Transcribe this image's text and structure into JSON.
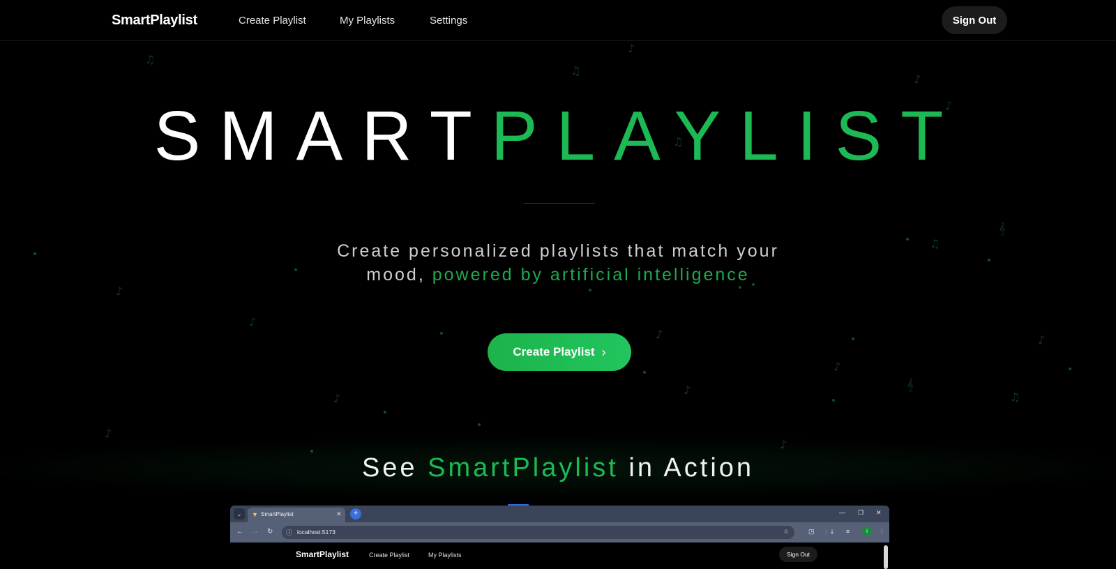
{
  "nav": {
    "brand": "SmartPlaylist",
    "links": [
      "Create Playlist",
      "My Playlists",
      "Settings"
    ],
    "sign_out": "Sign Out"
  },
  "hero": {
    "title_part1": "SMART",
    "title_part2": "PLAYLIST",
    "subtitle_part1": "Create personalized playlists that match your mood, ",
    "subtitle_highlight": "powered by artificial intelligence",
    "cta_label": "Create Playlist",
    "cta_icon": "chevron-right-icon"
  },
  "section": {
    "title_prefix": "See ",
    "title_highlight": "SmartPlaylist",
    "title_suffix": " in Action"
  },
  "preview": {
    "tab_title": "SmartPlaylist",
    "url": "localhost:5173",
    "profile_initial": "i",
    "brand": "SmartPlaylist",
    "links": [
      "Create Playlist",
      "My Playlists"
    ],
    "sign_out": "Sign Out"
  },
  "colors": {
    "accent": "#1db954",
    "background": "#000000"
  }
}
